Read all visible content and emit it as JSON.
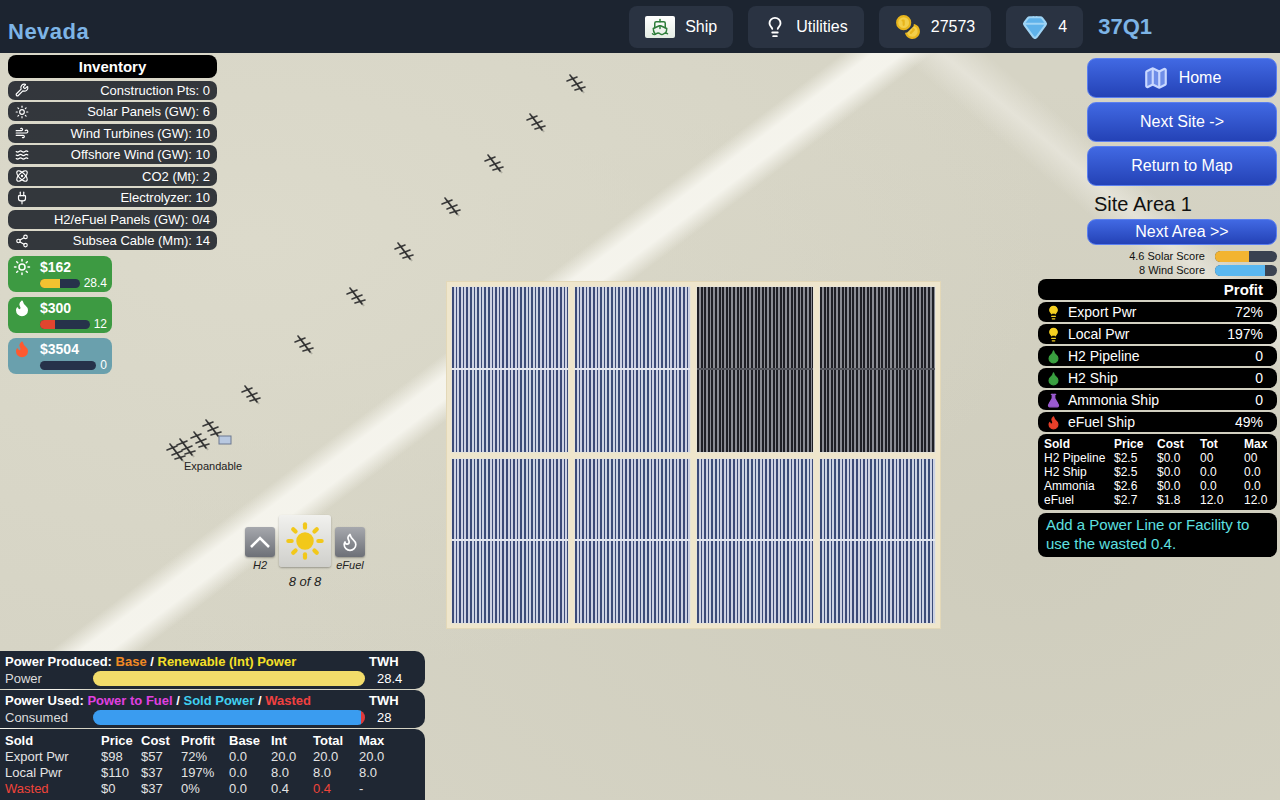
{
  "top_bar": {
    "region": "Nevada",
    "buttons": [
      {
        "kind": "ship",
        "label": "Ship"
      },
      {
        "kind": "utilities",
        "label": "Utilities"
      }
    ],
    "coins": "27573",
    "gems": "4",
    "quarter": "37Q1"
  },
  "inventory": {
    "title": "Inventory",
    "items": [
      {
        "kind": "tools",
        "label": "Construction Pts: 0"
      },
      {
        "kind": "solar",
        "label": "Solar Panels (GW): 6"
      },
      {
        "kind": "wind",
        "label": "Wind Turbines (GW): 10"
      },
      {
        "kind": "offshore",
        "label": "Offshore Wind (GW): 10"
      },
      {
        "kind": "co2",
        "label": "CO2 (Mt): 2"
      },
      {
        "kind": "electrolyzer",
        "label": "Electrolyzer: 10"
      },
      {
        "kind": "none",
        "label": "H2/eFuel Panels (GW): 0/4"
      },
      {
        "kind": "cable",
        "label": "Subsea Cable (Mm): 14"
      }
    ]
  },
  "markets": [
    {
      "kind": "solar",
      "price": "$162",
      "value": "28.4",
      "level": 0.5,
      "color": "#3d9a42",
      "bar_color": "#f2c230"
    },
    {
      "kind": "fuel",
      "price": "$300",
      "value": "12",
      "level": 0.3,
      "color": "#3d9a42",
      "bar_color": "#e2452f"
    },
    {
      "kind": "efuel",
      "price": "$3504",
      "value": "0",
      "level": 0,
      "color": "#6aa0ad",
      "bar_color": "#e2452f"
    }
  ],
  "map": {
    "panels": [
      {
        "dark": false
      },
      {
        "dark": false
      },
      {
        "dark": true
      },
      {
        "dark": true
      },
      {
        "dark": false
      },
      {
        "dark": false
      },
      {
        "dark": false
      },
      {
        "dark": false
      }
    ],
    "marker": "Expandable",
    "selector": {
      "items": [
        {
          "kind": "h2",
          "label": "H2",
          "selected": false
        },
        {
          "kind": "solar",
          "selected": true
        },
        {
          "kind": "efuel",
          "label": "eFuel",
          "selected": false
        }
      ],
      "count": "8 of 8"
    }
  },
  "right_panel": {
    "nav": [
      {
        "kind": "home",
        "label": "Home"
      },
      {
        "kind": "plain",
        "label": "Next Site ->"
      },
      {
        "kind": "plain",
        "label": "Return to Map"
      }
    ],
    "site": "Site Area 1",
    "next_area": "Next Area >>",
    "scores": [
      {
        "label": "4.6 Solar Score",
        "level": 0.55,
        "color": "#f2b431"
      },
      {
        "label": "8 Wind Score",
        "level": 0.8,
        "color": "#5ab8f0"
      }
    ],
    "profit": {
      "title": "Profit",
      "rows": [
        {
          "kind": "power",
          "label": "Export Pwr",
          "value": "72%"
        },
        {
          "kind": "power",
          "label": "Local Pwr",
          "value": "197%"
        },
        {
          "kind": "h2",
          "label": "H2 Pipeline",
          "value": "0"
        },
        {
          "kind": "h2",
          "label": "H2 Ship",
          "value": "0"
        },
        {
          "kind": "ammonia",
          "label": "Ammonia Ship",
          "value": "0"
        },
        {
          "kind": "efuel",
          "label": "eFuel Ship",
          "value": "49%"
        }
      ]
    },
    "sold": {
      "columns": [
        "Sold",
        "Price",
        "Cost",
        "Tot",
        "Max"
      ],
      "rows": [
        [
          "H2 Pipeline",
          "$2.5",
          "$0.0",
          "00",
          "00"
        ],
        [
          "H2 Ship",
          "$2.5",
          "$0.0",
          "0.0",
          "0.0"
        ],
        [
          "Ammonia",
          "$2.6",
          "$0.0",
          "0.0",
          "0.0"
        ],
        [
          "eFuel",
          "$2.7",
          "$1.8",
          "12.0",
          "12.0"
        ]
      ]
    },
    "message": "Add a Power Line or Facility to use the wasted 0.4."
  },
  "power": {
    "produced": {
      "title": "Power Produced:",
      "separator": "/",
      "legend": [
        {
          "label": "Base",
          "color": "#f08a24"
        },
        {
          "label": "Renewable (Int) Power",
          "color": "#f5e028"
        }
      ],
      "unit": "TWH",
      "row_label": "Power",
      "value": "28.4",
      "segments": [
        {
          "level": 1,
          "color": "#f2dc6a"
        }
      ]
    },
    "used": {
      "title": "Power Used:",
      "separator": "/",
      "legend": [
        {
          "label": "Power to Fuel",
          "color": "#e040e0"
        },
        {
          "label": "Sold Power",
          "color": "#40d0f0"
        },
        {
          "label": "Wasted",
          "color": "#f04040"
        }
      ],
      "unit": "TWH",
      "row_label": "Consumed",
      "value": "28",
      "segments": [
        {
          "level": 0.985,
          "color": "#3a9cf0"
        },
        {
          "level": 0.015,
          "color": "#e03a3a"
        }
      ]
    },
    "sold": {
      "columns": [
        "Sold",
        "Price",
        "Cost",
        "Profit",
        "Base",
        "Int",
        "Total",
        "Max"
      ],
      "rows": [
        {
          "cells": [
            "Export Pwr",
            "$98",
            "$57",
            "72%",
            "0.0",
            "20.0",
            "20.0",
            "20.0"
          ],
          "wasted": false
        },
        {
          "cells": [
            "Local Pwr",
            "$110",
            "$37",
            "197%",
            "0.0",
            "8.0",
            "8.0",
            "8.0"
          ],
          "wasted": false
        },
        {
          "cells": [
            "Wasted",
            "$0",
            "$37",
            "0%",
            "0.0",
            "0.4",
            "0.4",
            "-"
          ],
          "wasted": true
        }
      ]
    }
  }
}
